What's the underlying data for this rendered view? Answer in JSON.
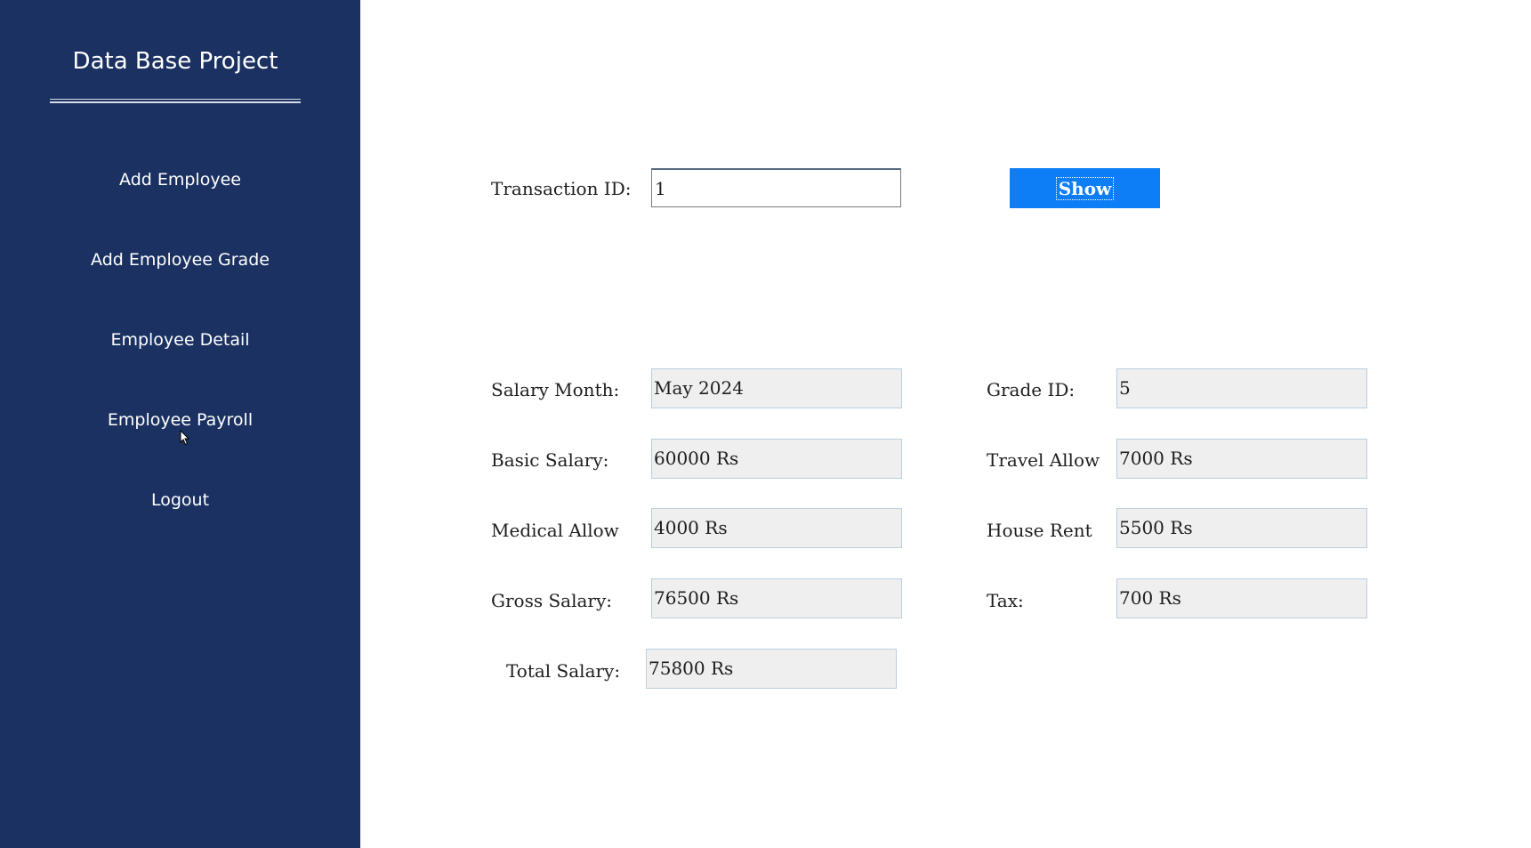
{
  "sidebar": {
    "title": "Data Base Project",
    "items": [
      {
        "label": "Add Employee"
      },
      {
        "label": "Add Employee Grade"
      },
      {
        "label": "Employee Detail"
      },
      {
        "label": "Employee Payroll"
      },
      {
        "label": "Logout"
      }
    ]
  },
  "search": {
    "label": "Transaction ID:",
    "value": "1",
    "button_label": "Show"
  },
  "payroll": {
    "salary_month": {
      "label": "Salary Month:",
      "value": "May 2024"
    },
    "grade_id": {
      "label": "Grade ID:",
      "value": "5"
    },
    "basic_salary": {
      "label": "Basic Salary:",
      "value": "60000 Rs"
    },
    "travel_allow": {
      "label": "Travel Allow",
      "value": "7000 Rs"
    },
    "medical_allow": {
      "label": "Medical Allow",
      "value": "4000 Rs"
    },
    "house_rent": {
      "label": "House Rent",
      "value": "5500 Rs"
    },
    "gross_salary": {
      "label": "Gross Salary:",
      "value": "76500 Rs"
    },
    "tax": {
      "label": "Tax:",
      "value": "700 Rs"
    },
    "total_salary": {
      "label": "Total Salary:",
      "value": "75800 Rs"
    }
  },
  "colors": {
    "sidebar_bg": "#1b3161",
    "button_bg": "#0d7ef5",
    "field_bg": "#efefef",
    "field_border": "#b9cfe0"
  },
  "icons": {
    "cursor": "mouse-pointer-icon"
  }
}
